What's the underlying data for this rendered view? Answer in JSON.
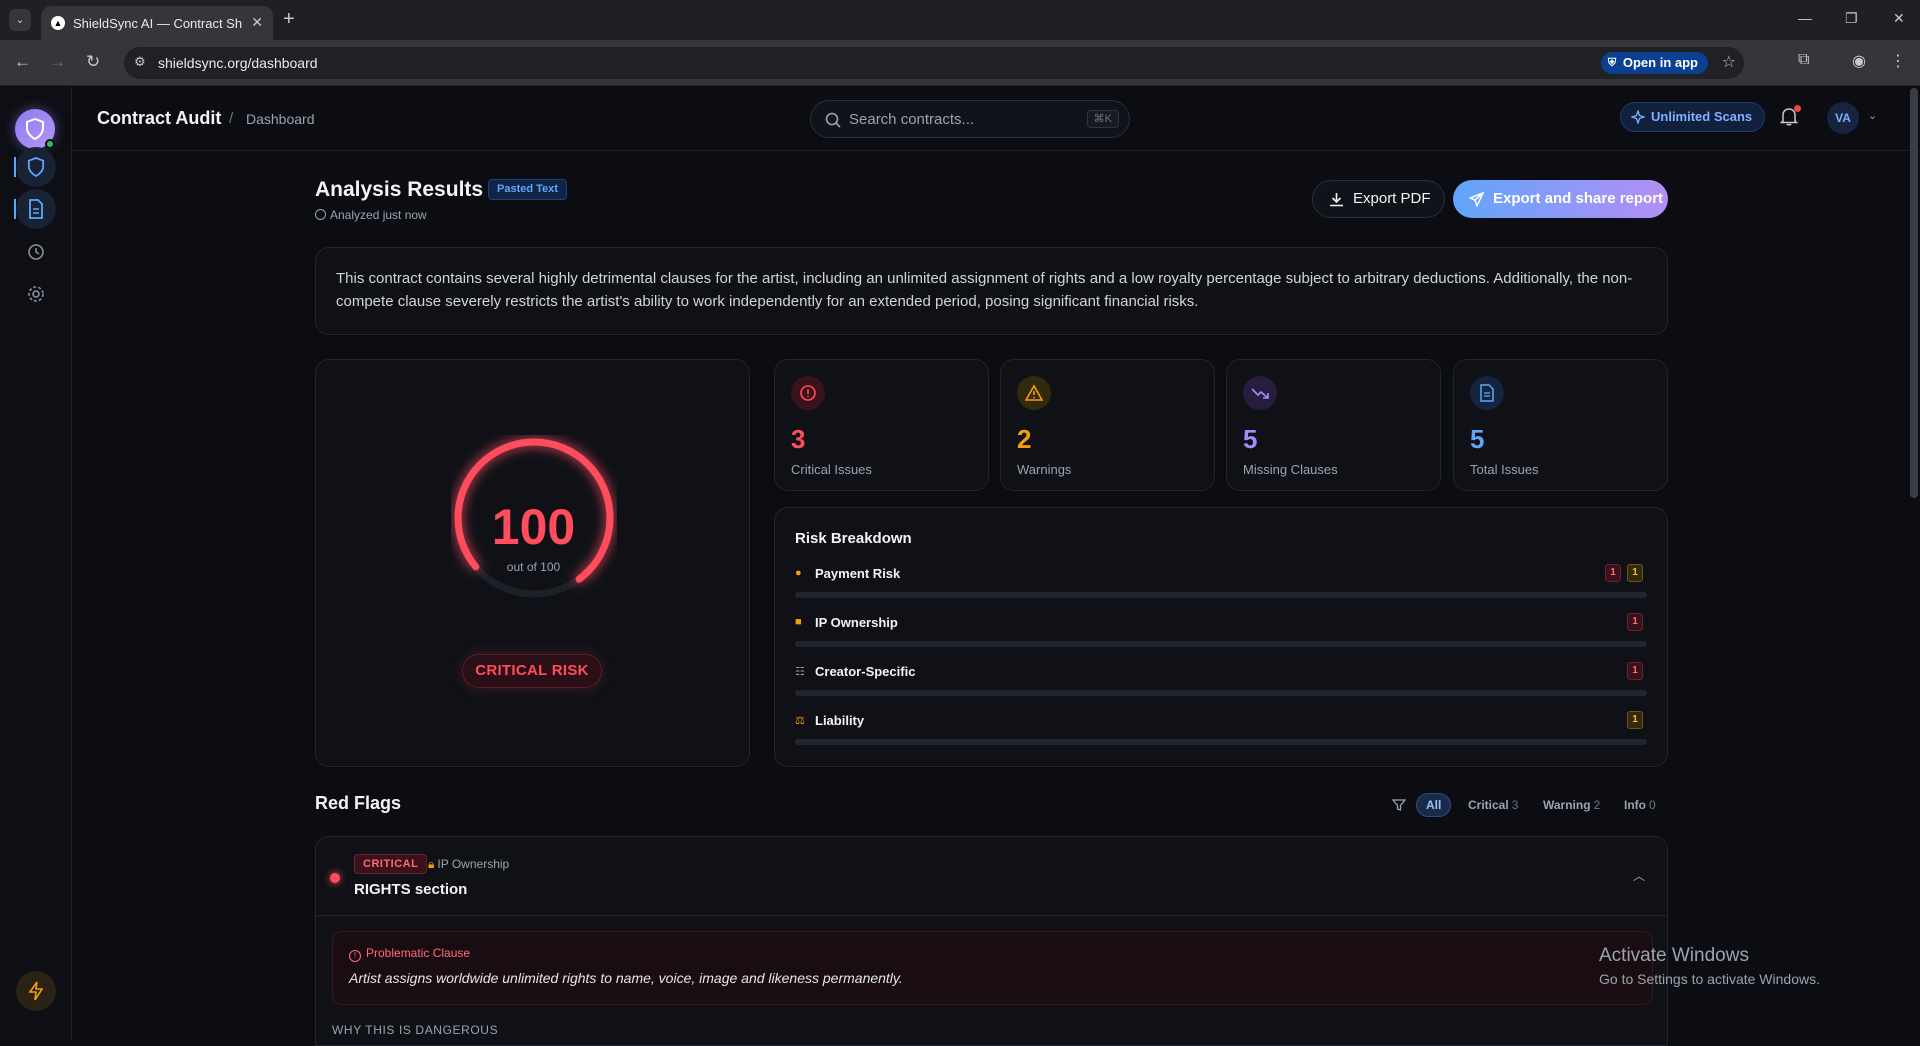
{
  "browser": {
    "tab_title": "ShieldSync AI — Contract Shield",
    "url": "shieldsync.org/dashboard",
    "open_in_app": "Open in app"
  },
  "topbar": {
    "title": "Contract Audit",
    "separator": "/",
    "breadcrumb": "Dashboard",
    "search_placeholder": "Search contracts...",
    "search_shortcut": "⌘K",
    "plan_label": "Unlimited Scans",
    "avatar_initials": "VA"
  },
  "header": {
    "title": "Analysis Results",
    "source_badge": "Pasted Text",
    "analyzed": "Analyzed just now",
    "export_pdf": "Export PDF",
    "export_share": "Export and share report"
  },
  "summary": "This contract contains several highly detrimental clauses for the artist, including an unlimited assignment of rights and a low royalty percentage subject to arbitrary deductions. Additionally, the non-compete clause severely restricts the artist's ability to work independently for an extended period, posing significant financial risks.",
  "score": {
    "value": "100",
    "out_of": "out of 100",
    "fraction": 1.0,
    "risk_label": "CRITICAL RISK",
    "color": "#ff4d5e"
  },
  "stats": [
    {
      "value": "3",
      "label": "Critical Issues",
      "color": "#ff4d5e",
      "icon": "alert-circle-icon"
    },
    {
      "value": "2",
      "label": "Warnings",
      "color": "#f59e0b",
      "icon": "warning-triangle-icon"
    },
    {
      "value": "5",
      "label": "Missing Clauses",
      "color": "#a78bfa",
      "icon": "trending-down-icon"
    },
    {
      "value": "5",
      "label": "Total Issues",
      "color": "#60a5fa",
      "icon": "document-icon"
    }
  ],
  "breakdown": {
    "title": "Risk Breakdown",
    "rows": [
      {
        "label": "Payment Risk",
        "icon": "money-bag-icon",
        "critical": "1",
        "warning": "1"
      },
      {
        "label": "IP Ownership",
        "icon": "lock-icon",
        "critical": "1",
        "warning": ""
      },
      {
        "label": "Creator-Specific",
        "icon": "sliders-icon",
        "critical": "1",
        "warning": ""
      },
      {
        "label": "Liability",
        "icon": "scales-icon",
        "critical": "",
        "warning": "1"
      }
    ]
  },
  "red_flags": {
    "title": "Red Flags",
    "filters": [
      {
        "label": "All",
        "count": ""
      },
      {
        "label": "Critical",
        "count": "3"
      },
      {
        "label": "Warning",
        "count": "2"
      },
      {
        "label": "Info",
        "count": "0"
      }
    ],
    "items": [
      {
        "severity": "CRITICAL",
        "category": "IP Ownership",
        "section": "RIGHTS section",
        "problem_heading": "Problematic Clause",
        "clause": "Artist assigns worldwide unlimited rights to name, voice, image and likeness permanently.",
        "why_heading": "WHY THIS IS DANGEROUS"
      }
    ]
  },
  "os_overlay": {
    "line1": "Activate Windows",
    "line2": "Go to Settings to activate Windows."
  }
}
